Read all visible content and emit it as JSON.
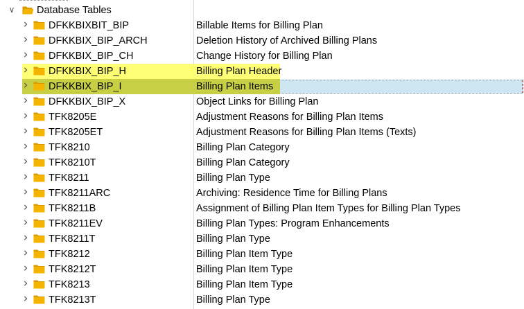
{
  "tree": {
    "root": {
      "label": "Database Tables",
      "expanded": true,
      "icon": "folder-open-icon"
    },
    "rows": [
      {
        "name": "DFKKBIXBIT_BIP",
        "desc": "Billable Items for Billing Plan",
        "highlight": "none"
      },
      {
        "name": "DFKKBIX_BIP_ARCH",
        "desc": "Deletion History of Archived Billing Plans",
        "highlight": "none"
      },
      {
        "name": "DFKKBIX_BIP_CH",
        "desc": "Change History for Billing Plan",
        "highlight": "none"
      },
      {
        "name": "DFKKBIX_BIP_H",
        "desc": "Billing Plan Header",
        "highlight": "yellow"
      },
      {
        "name": "DFKKBIX_BIP_I",
        "desc": "Billing Plan Items",
        "highlight": "selected"
      },
      {
        "name": "DFKKBIX_BIP_X",
        "desc": "Object Links for Billing Plan",
        "highlight": "none"
      },
      {
        "name": "TFK8205E",
        "desc": "Adjustment Reasons for Billing Plan Items",
        "highlight": "none"
      },
      {
        "name": "TFK8205ET",
        "desc": "Adjustment Reasons for Billing Plan Items (Texts)",
        "highlight": "none"
      },
      {
        "name": "TFK8210",
        "desc": "Billing Plan Category",
        "highlight": "none"
      },
      {
        "name": "TFK8210T",
        "desc": "Billing Plan Category",
        "highlight": "none"
      },
      {
        "name": "TFK8211",
        "desc": "Billing Plan Type",
        "highlight": "none"
      },
      {
        "name": "TFK8211ARC",
        "desc": "Archiving: Residence Time for Billing Plans",
        "highlight": "none"
      },
      {
        "name": "TFK8211B",
        "desc": "Assignment of Billing Plan Item Types for Billing Plan Types",
        "highlight": "none"
      },
      {
        "name": "TFK8211EV",
        "desc": "Billing Plan Types: Program Enhancements",
        "highlight": "none"
      },
      {
        "name": "TFK8211T",
        "desc": "Billing Plan Type",
        "highlight": "none"
      },
      {
        "name": "TFK8212",
        "desc": "Billing Plan Item Type",
        "highlight": "none"
      },
      {
        "name": "TFK8212T",
        "desc": "Billing Plan Item Type",
        "highlight": "none"
      },
      {
        "name": "TFK8213",
        "desc": "Billing Plan Item Type",
        "highlight": "none"
      },
      {
        "name": "TFK8213T",
        "desc": "Billing Plan Type",
        "highlight": "none"
      }
    ]
  },
  "colors": {
    "folder": "#f4b400",
    "folder_dark": "#d99a00",
    "highlight_yellow": "#ffff66",
    "highlight_olive": "#c7cf45",
    "selection_blue": "#cde6f2",
    "divider": "#d8d8d8"
  }
}
